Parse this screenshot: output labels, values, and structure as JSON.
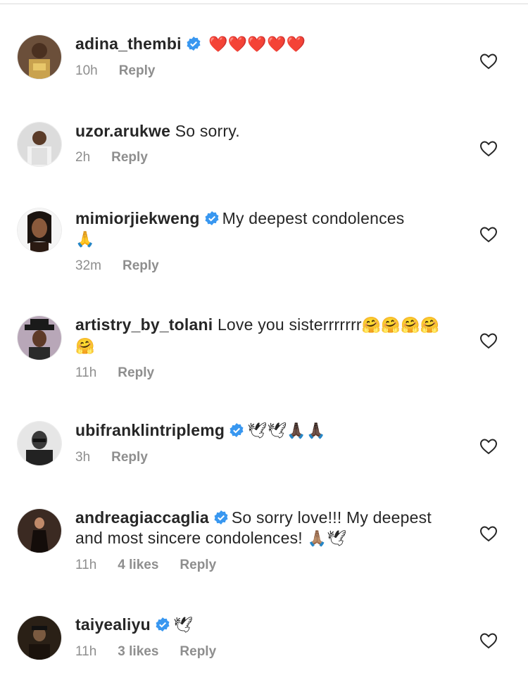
{
  "comments": [
    {
      "username": "adina_thembi",
      "verified": true,
      "text": "",
      "emoji": "❤️❤️❤️❤️❤️",
      "time": "10h",
      "likes": "",
      "reply": "Reply"
    },
    {
      "username": "uzor.arukwe",
      "verified": false,
      "text": "So sorry.",
      "emoji": "",
      "time": "2h",
      "likes": "",
      "reply": "Reply"
    },
    {
      "username": "mimiorjiekweng",
      "verified": true,
      "text": "My deepest condolences",
      "emoji": "🙏",
      "time": "32m",
      "likes": "",
      "reply": "Reply"
    },
    {
      "username": "artistry_by_tolani",
      "verified": false,
      "text": "Love you sisterrrrrrr",
      "emoji": "🤗🤗🤗🤗🤗",
      "time": "11h",
      "likes": "",
      "reply": "Reply"
    },
    {
      "username": "ubifranklintriplemg",
      "verified": true,
      "text": "",
      "emoji": "🕊🕊🙏🏿🙏🏿",
      "time": "3h",
      "likes": "",
      "reply": "Reply"
    },
    {
      "username": "andreagiaccaglia",
      "verified": true,
      "text": "So sorry love!!! My deepest and most sincere condolences!",
      "emoji": "🙏🏽🕊",
      "time": "11h",
      "likes": "4 likes",
      "reply": "Reply"
    },
    {
      "username": "taiyealiyu",
      "verified": true,
      "text": "",
      "emoji": "🕊",
      "time": "11h",
      "likes": "3 likes",
      "reply": "Reply"
    }
  ],
  "colors": {
    "verified": "#3897f0",
    "meta": "#8e8e8e",
    "text": "#262626"
  },
  "icons": {
    "verified": "verified-badge-icon",
    "like": "heart-outline-icon"
  }
}
